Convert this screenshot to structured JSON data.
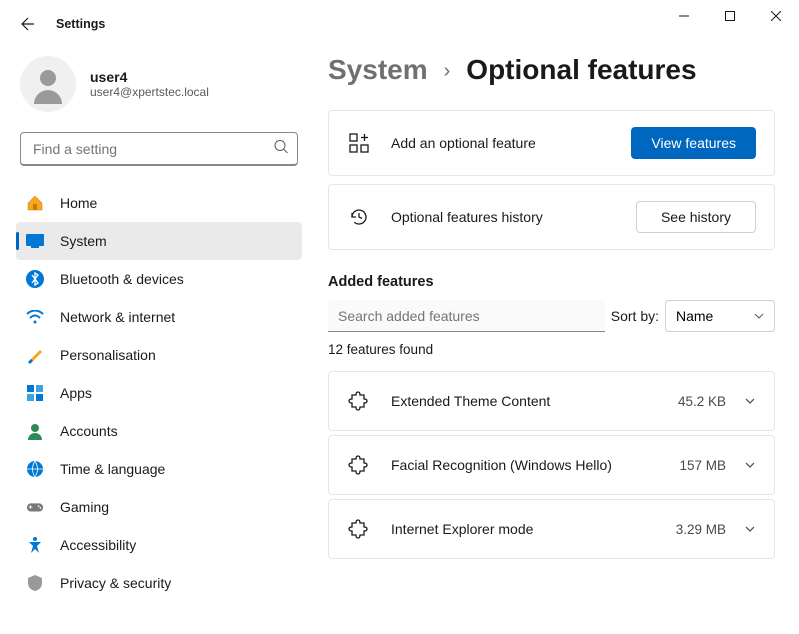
{
  "window": {
    "title": "Settings"
  },
  "user": {
    "name": "user4",
    "email": "user4@xpertstec.local"
  },
  "search": {
    "placeholder": "Find a setting"
  },
  "nav": [
    {
      "id": "home",
      "label": "Home",
      "icon": "home"
    },
    {
      "id": "system",
      "label": "System",
      "icon": "system",
      "active": true
    },
    {
      "id": "bluetooth",
      "label": "Bluetooth & devices",
      "icon": "bluetooth"
    },
    {
      "id": "network",
      "label": "Network & internet",
      "icon": "wifi"
    },
    {
      "id": "personalisation",
      "label": "Personalisation",
      "icon": "brush"
    },
    {
      "id": "apps",
      "label": "Apps",
      "icon": "apps"
    },
    {
      "id": "accounts",
      "label": "Accounts",
      "icon": "person"
    },
    {
      "id": "time",
      "label": "Time & language",
      "icon": "globe"
    },
    {
      "id": "gaming",
      "label": "Gaming",
      "icon": "gamepad"
    },
    {
      "id": "accessibility",
      "label": "Accessibility",
      "icon": "accessibility"
    },
    {
      "id": "privacy",
      "label": "Privacy & security",
      "icon": "shield"
    }
  ],
  "breadcrumb": {
    "parent": "System",
    "current": "Optional features"
  },
  "cards": {
    "add": {
      "text": "Add an optional feature",
      "button": "View features"
    },
    "history": {
      "text": "Optional features history",
      "button": "See history"
    }
  },
  "added": {
    "heading": "Added features",
    "search_placeholder": "Search added features",
    "sort_label": "Sort by:",
    "sort_value": "Name",
    "count": "12 features found"
  },
  "features": [
    {
      "name": "Extended Theme Content",
      "size": "45.2 KB"
    },
    {
      "name": "Facial Recognition (Windows Hello)",
      "size": "157 MB"
    },
    {
      "name": "Internet Explorer mode",
      "size": "3.29 MB"
    }
  ]
}
